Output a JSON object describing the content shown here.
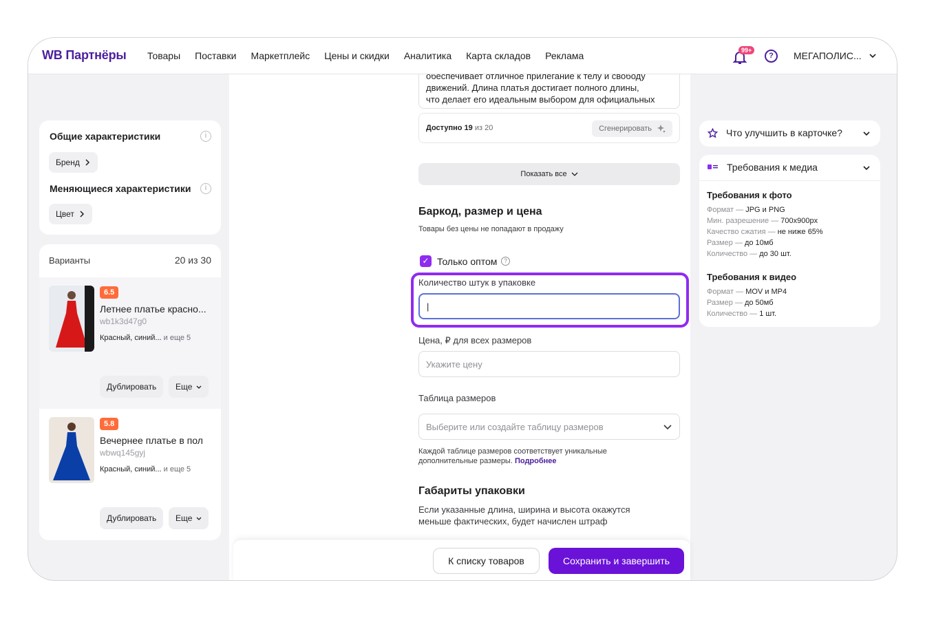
{
  "header": {
    "logo": "WB Партнёры",
    "nav": [
      "Товары",
      "Поставки",
      "Маркетплейс",
      "Цены и скидки",
      "Аналитика",
      "Карта складов",
      "Реклама"
    ],
    "notifications_badge": "99+",
    "help_icon_text": "?",
    "account_name": "МЕГАПОЛИС..."
  },
  "left": {
    "general_title": "Общие характеристики",
    "brand_chip": "Бренд",
    "changing_title": "Меняющиеся характеристики",
    "color_chip": "Цвет",
    "info_icon_text": "i",
    "variants_title": "Варианты",
    "variants_count": "20 из 30",
    "variants": [
      {
        "rating": "6.5",
        "title": "Летнее платье красно...",
        "code": "wb1k3d47g0",
        "colors": "Красный, синий...",
        "more": "и еще 5",
        "duplicate": "Дублировать",
        "more_btn": "Еще"
      },
      {
        "rating": "5.8",
        "title": "Вечернее платье в пол",
        "code": "wbwq145gyj",
        "colors": "Красный, синий...",
        "more": "и еще 5",
        "duplicate": "Дублировать",
        "more_btn": "Еще"
      }
    ]
  },
  "center": {
    "description_lines": [
      "обеспечивает отличное прилегание к телу и свободу",
      "движений. Длина платья достигает полного длины,",
      "что делает его идеальным выбором для официальных"
    ],
    "available_label": "Доступно",
    "available_count": "19",
    "available_of": "из 20",
    "generate_btn": "Сгенерировать",
    "show_all": "Показать все",
    "barcode_title": "Баркод, размер и цена",
    "barcode_sub": "Товары без цены не попадают в продажу",
    "wholesale_label": "Только оптом",
    "wholesale_checkmark": "✓",
    "wholesale_help": "?",
    "qty_label": "Количество штук в упаковке",
    "qty_value": "|",
    "price_label": "Цена, ₽  для всех размеров",
    "price_placeholder": "Укажите цену",
    "size_table_label": "Таблица размеров",
    "size_table_placeholder": "Выберите или создайте таблицу размеров",
    "size_hint_1": "Каждой таблице размеров соответствует уникальные",
    "size_hint_2": "дополнительные размеры.",
    "size_hint_link": "Подробнее",
    "dims_title": "Габариты упаковки",
    "dims_desc_1": "Если указанные длина, ширина и высота окажутся",
    "dims_desc_2": "меньше фактических, будет начислен штраф"
  },
  "footer": {
    "back_btn": "К списку товаров",
    "save_btn": "Сохранить и завершить"
  },
  "right": {
    "improve_title": "Что улучшить в карточке?",
    "media_title": "Требования к медиа",
    "photo_title": "Требования к фото",
    "photo_lines": [
      {
        "k": "Формат —",
        "v": "JPG и PNG"
      },
      {
        "k": "Мин. разрешение —",
        "v": "700x900px"
      },
      {
        "k": "Качество сжатия —",
        "v": "не ниже 65%"
      },
      {
        "k": "Размер —",
        "v": "до 10мб"
      },
      {
        "k": "Количество —",
        "v": "до 30 шт."
      }
    ],
    "video_title": "Требования к видео",
    "video_lines": [
      {
        "k": "Формат —",
        "v": "MOV и MP4"
      },
      {
        "k": "Размер —",
        "v": "до 50мб"
      },
      {
        "k": "Количество —",
        "v": "1 шт."
      }
    ]
  },
  "colors": {
    "brand": "#4b1f9e",
    "accent": "#8f2cf0",
    "primary_button": "#6b12d8",
    "rating": "#ff6c3a"
  }
}
